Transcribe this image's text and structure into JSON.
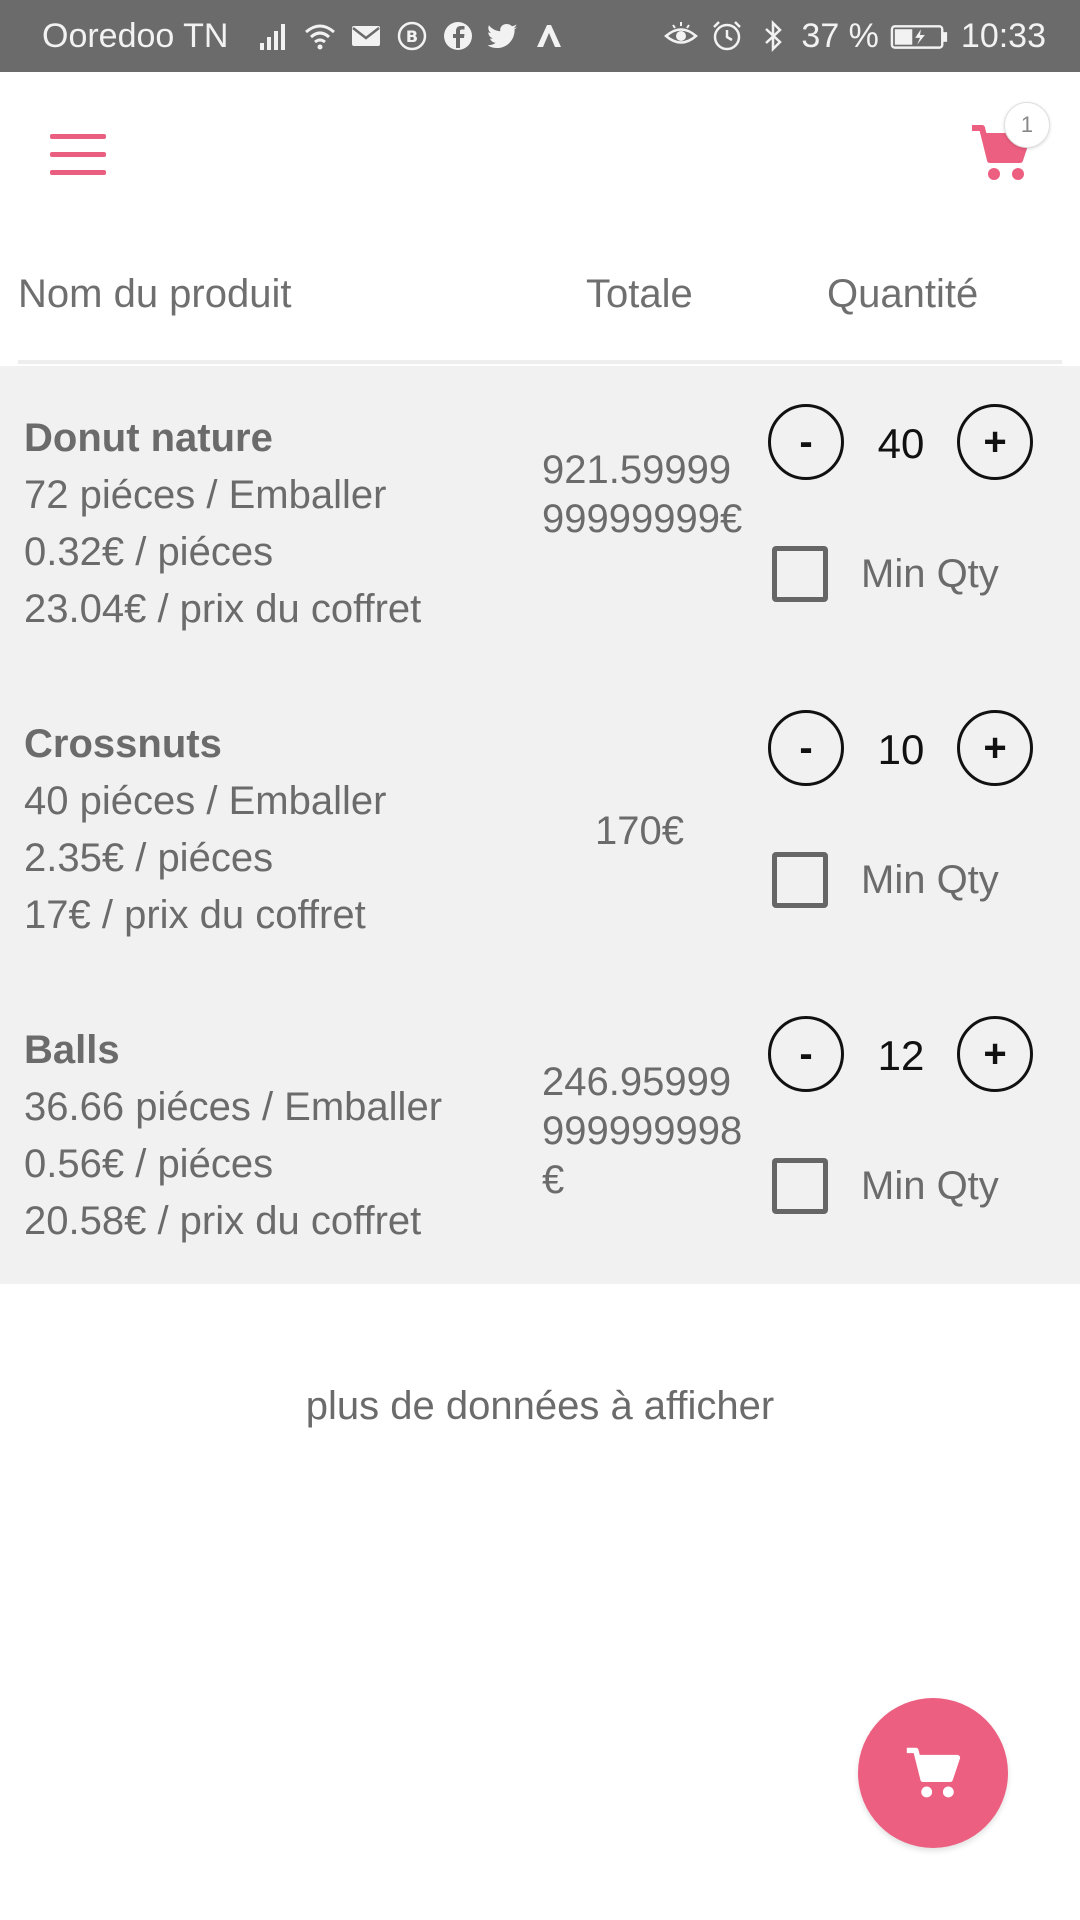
{
  "status_bar": {
    "carrier": "Ooredoo TN",
    "battery": "37 %",
    "time": "10:33",
    "icons_left": [
      "signal-icon",
      "wifi-icon",
      "mail-icon",
      "b-icon",
      "facebook-icon",
      "twitter-icon",
      "app-icon"
    ],
    "icons_right": [
      "eye-icon",
      "alarm-icon",
      "bluetooth-icon",
      "battery-icon"
    ]
  },
  "header": {
    "menu_icon": "hamburger-icon",
    "cart_icon": "cart-icon",
    "cart_count": "1",
    "accent": "#ec5f80"
  },
  "table": {
    "headers": {
      "name": "Nom du produit",
      "total": "Totale",
      "quantity": "Quantité"
    },
    "rows": [
      {
        "name": "Donut nature",
        "pieces": "72  piéces / Emballer",
        "unit_price": "0.32€ / piéces",
        "box_price": "23.04€ / prix du coffret",
        "total": "921.5999999999999€",
        "quantity": "40",
        "minus_label": "-",
        "plus_label": "+",
        "min_qty_label": "Min Qty"
      },
      {
        "name": "Crossnuts",
        "pieces": "40  piéces / Emballer",
        "unit_price": "2.35€ / piéces",
        "box_price": "17€ / prix du coffret",
        "total": "170€",
        "quantity": "10",
        "minus_label": "-",
        "plus_label": "+",
        "min_qty_label": "Min Qty"
      },
      {
        "name": "Balls",
        "pieces": "36.66  piéces / Emballer",
        "unit_price": "0.56€ / piéces",
        "box_price": "20.58€ / prix du coffret",
        "total": "246.95999999999998€",
        "quantity": "12",
        "minus_label": "-",
        "plus_label": "+",
        "min_qty_label": "Min Qty"
      }
    ]
  },
  "more_link": "plus de données à afficher",
  "fab_icon": "cart-icon"
}
